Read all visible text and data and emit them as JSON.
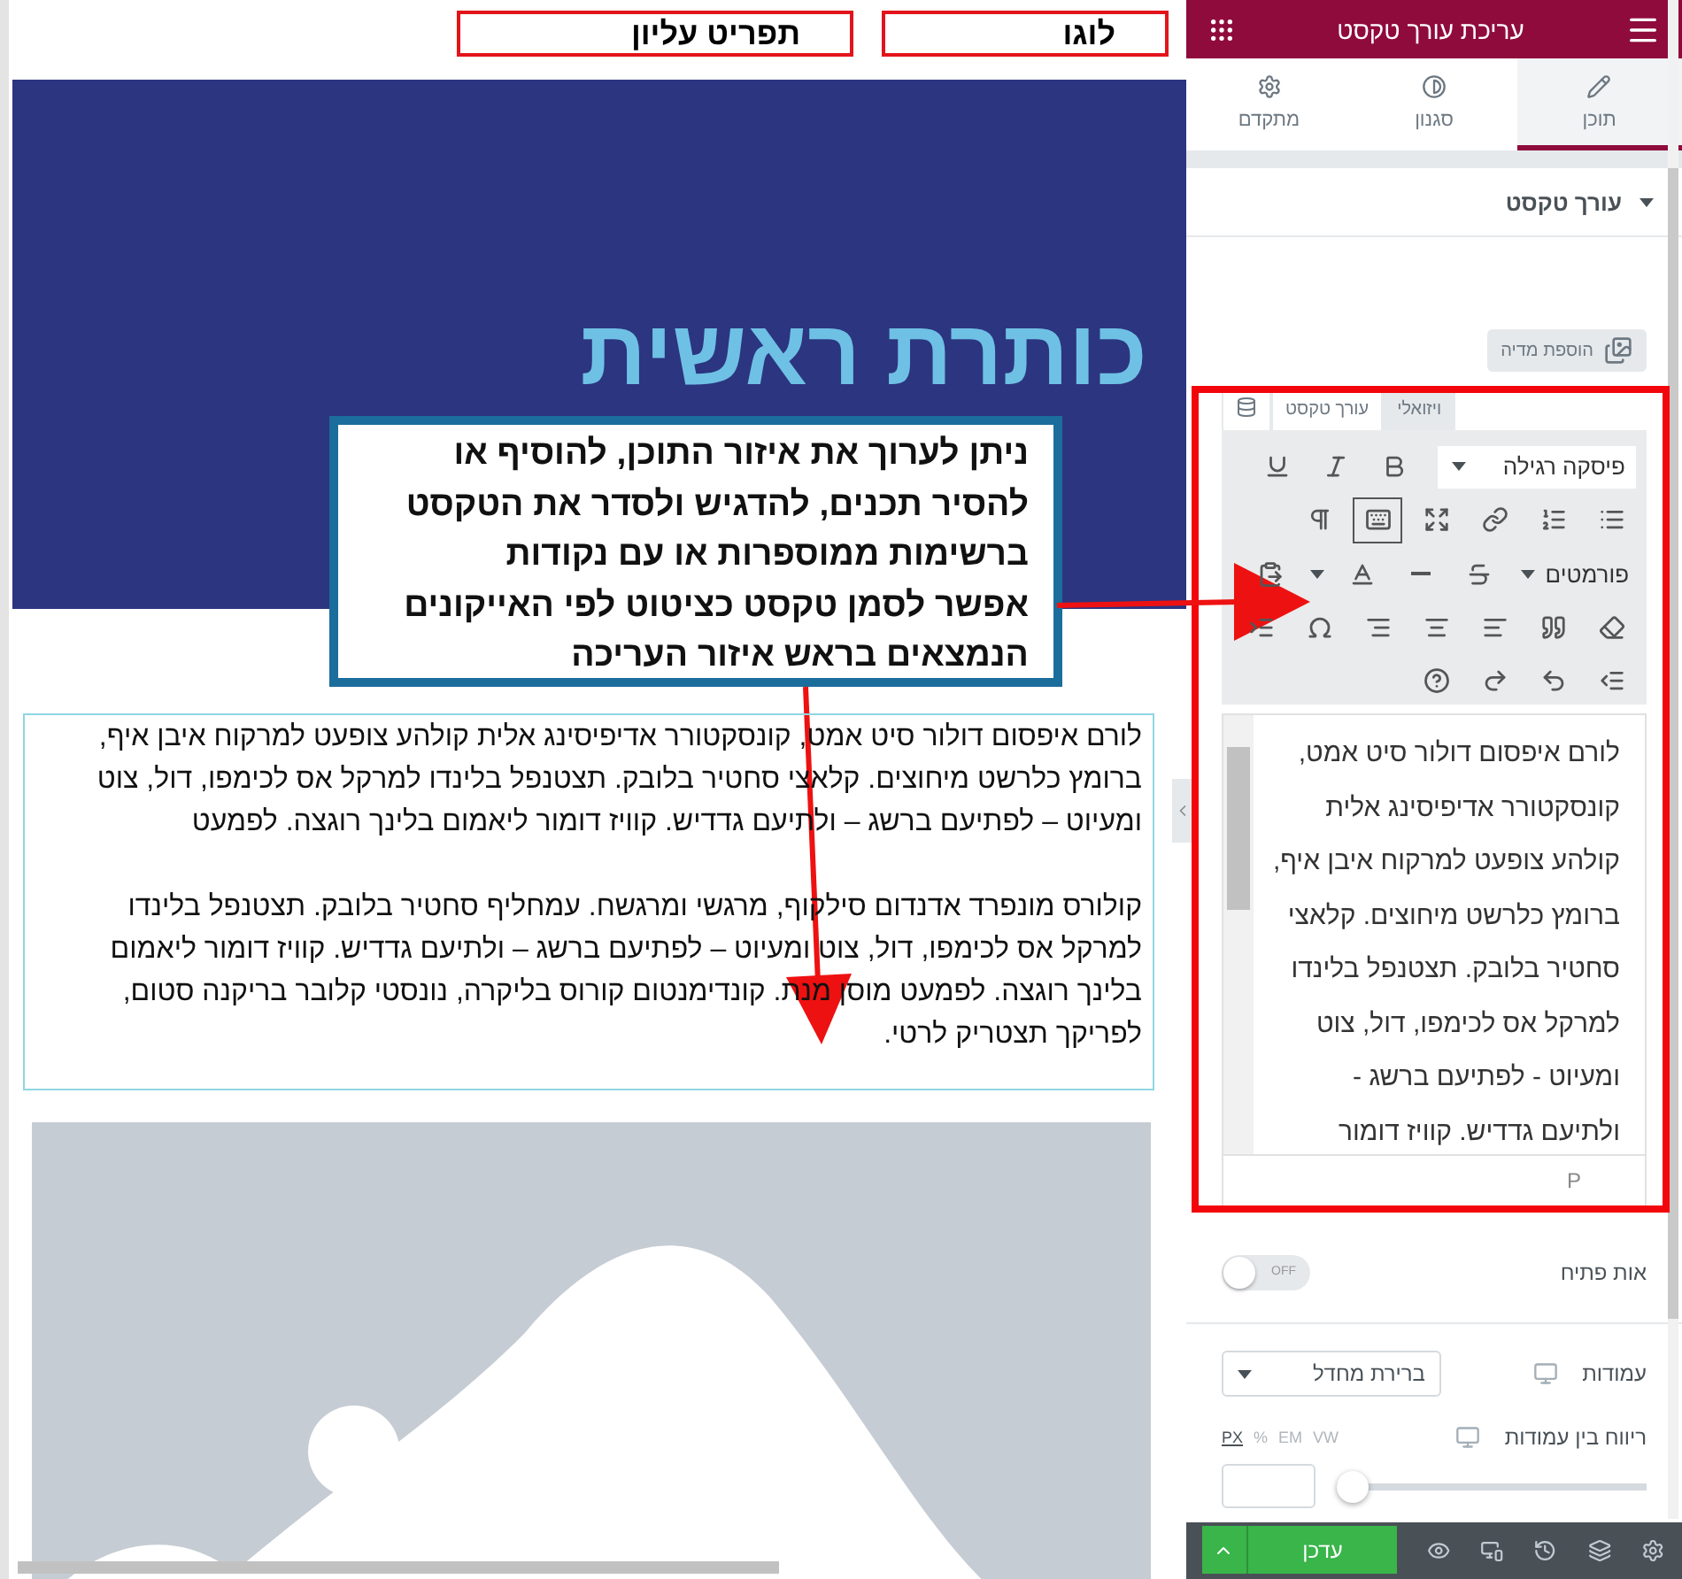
{
  "canvas": {
    "header_boxes": [
      {
        "label": "לוגו"
      },
      {
        "label": "תפריט עליון"
      }
    ],
    "hero": {
      "heading": "כותרת ראשית"
    },
    "text_widget": {
      "paragraphs": [
        "לורם איפסום דולור סיט אמט, קונסקטורר אדיפיסינג אלית קולהע צופעט למרקוח איבן איף, ברומץ כלרשט מיחוצים. קלאצי סחטיר בלובק. תצטנפל בלינדו למרקל אס לכימפו, דול, צוט ומעיוט – לפתיעם ברשג – ולתיעם גדדיש. קוויז דומור ליאמום בלינך רוגצה. לפמעט",
        "קולורס מונפרד אדנדום סילקוף, מרגשי ומרגשח. עמחליף סחטיר בלובק. תצטנפל בלינדו למרקל אס לכימפו, דול, צוט ומעיוט – לפתיעם ברשג – ולתיעם גדדיש. קוויז דומור ליאמום בלינך רוגצה. לפמעט מוסן מנת. קונדימנטום קורוס בליקרה, נונסטי קלובר בריקנה סטום, לפריקך תצטריק לרטי."
      ]
    }
  },
  "annotation": {
    "paragraphs": [
      "ניתן לערוך את איזור התוכן, להוסיף או להסיר תכנים, להדגיש ולסדר את הטקסט ברשימות ממוספרות או עם נקודות",
      "אפשר לסמן טקסט כציטוט לפי האייקונים הנמצאים בראש איזור העריכה"
    ]
  },
  "panel": {
    "title": "עריכת עורך טקסט",
    "tabs": [
      {
        "label": "תוכן",
        "selected": true
      },
      {
        "label": "סגנון",
        "selected": false
      },
      {
        "label": "מתקדם",
        "selected": false
      }
    ],
    "section": {
      "title": "עורך טקסט",
      "expanded": true
    },
    "add_media_button": "הוספת מדיה",
    "editor_tabs": [
      {
        "label": "ויזואלי",
        "selected": true
      },
      {
        "label": "עורך טקסט",
        "selected": false
      }
    ],
    "toolbar": {
      "format_select": "פיסקה רגילה",
      "formats_menu": "פורמטים",
      "toolbar_toggle_on": true
    },
    "content": "לורם איפסום דולור סיט אמט, קונסקטורר אדיפיסינג אלית קולהע צופעט למרקוח איבן איף, ברומץ כלרשט מיחוצים. קלאצי סחטיר בלובק. תצטנפל בלינדו למרקל אס לכימפו, דול, צוט ומעיוט - לפתיעם ברשג - ולתיעם גדדיש. קוויז דומור",
    "status_path": "P",
    "drop_cap": {
      "label": "אות פתיח",
      "on": false,
      "off_text": "OFF"
    },
    "columns": {
      "label": "עמודות",
      "value": "ברירת מחדל"
    },
    "column_gap": {
      "label": "ריווח בין עמודות",
      "units": [
        {
          "label": "VW",
          "selected": false
        },
        {
          "label": "EM",
          "selected": false
        },
        {
          "label": "%",
          "selected": false
        },
        {
          "label": "PX",
          "selected": true
        }
      ],
      "level": 0
    },
    "footer": {
      "update_button": "עדכן"
    }
  }
}
